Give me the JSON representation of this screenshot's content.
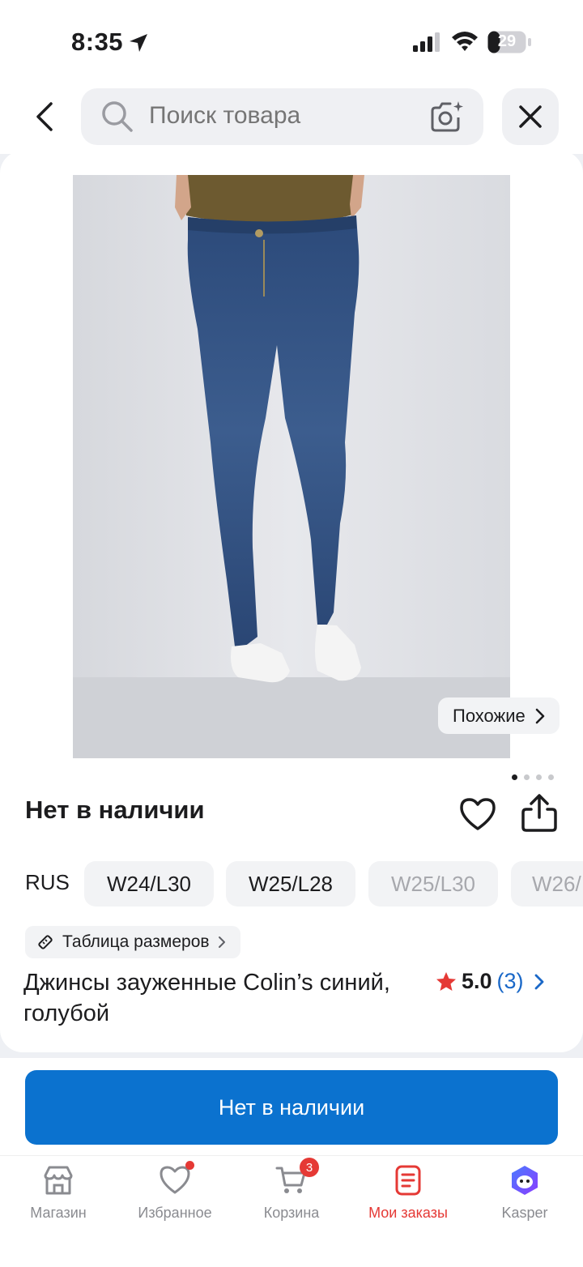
{
  "status_bar": {
    "time": "8:35",
    "battery": "29"
  },
  "header": {
    "search_placeholder": "Поиск товара"
  },
  "product": {
    "similar_label": "Похожие",
    "stock_status": "Нет в наличии",
    "size_system": "RUS",
    "sizes": [
      {
        "label": "W24/L30",
        "available": true
      },
      {
        "label": "W25/L28",
        "available": true
      },
      {
        "label": "W25/L30",
        "available": false
      },
      {
        "label": "W26/",
        "available": false
      }
    ],
    "size_table_label": "Таблица размеров",
    "title": "Джинсы зауженные Colin’s синий, голубой",
    "rating": "5.0",
    "reviews": "(3)",
    "image_pages": 4,
    "active_page": 1
  },
  "cta": {
    "label": "Нет в наличии"
  },
  "tabs": [
    {
      "label": "Магазин",
      "icon": "shop-icon"
    },
    {
      "label": "Избранное",
      "icon": "heart-icon"
    },
    {
      "label": "Корзина",
      "icon": "cart-icon",
      "badge": "3"
    },
    {
      "label": "Мои заказы",
      "icon": "orders-icon",
      "active": true
    },
    {
      "label": "Kasper",
      "icon": "kasper-icon"
    }
  ],
  "colors": {
    "accent": "#0b72cf",
    "active_tab": "#e53935",
    "rating_star": "#e53935",
    "link": "#1a68c8"
  }
}
